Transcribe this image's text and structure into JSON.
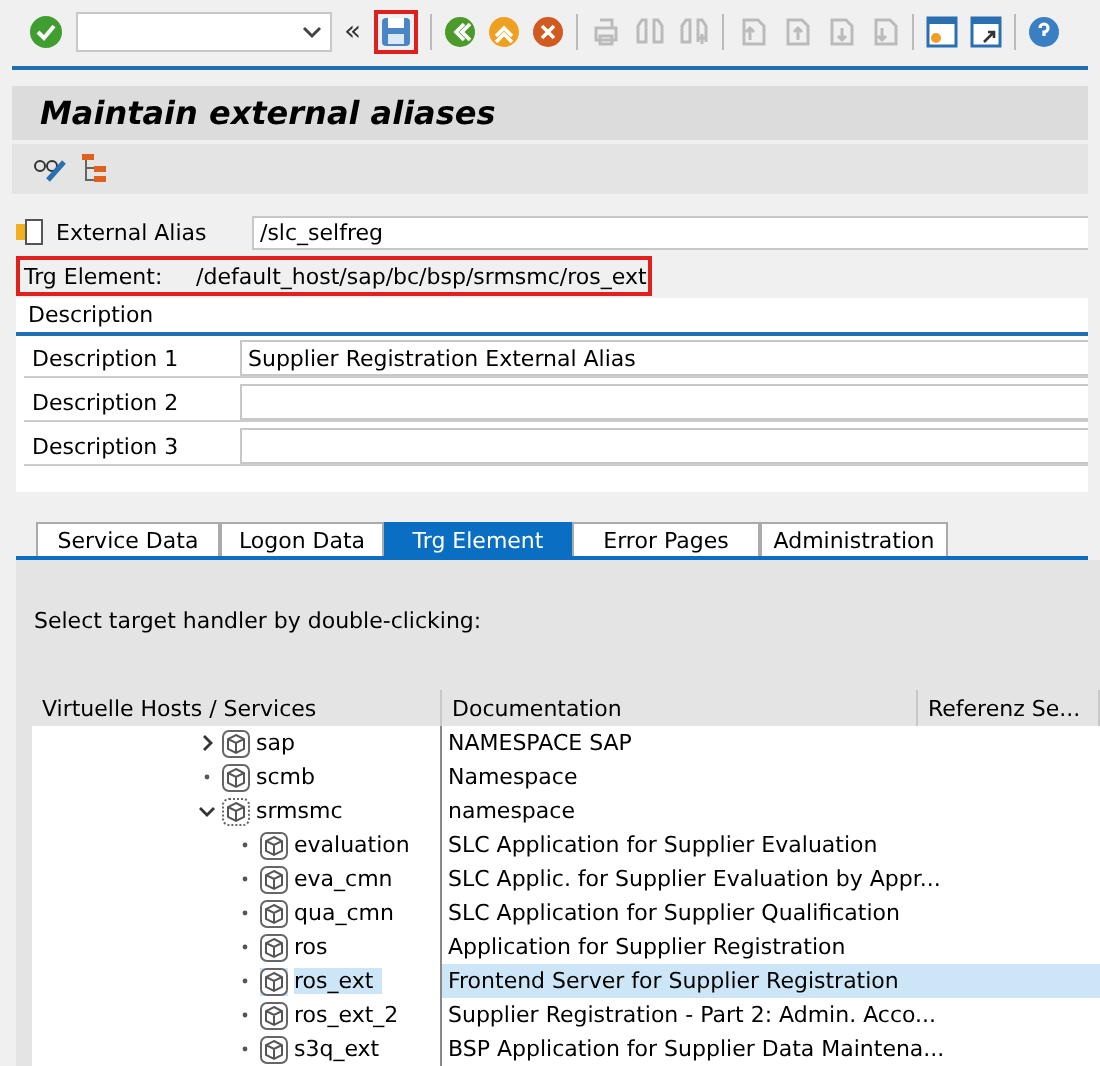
{
  "toolbar": {
    "nav_symbol": "«"
  },
  "title": "Maintain external aliases",
  "alias": {
    "label": "External Alias",
    "value": "/slc_selfreg"
  },
  "target": {
    "label": "Trg Element:",
    "value": "/default_host/sap/bc/bsp/srmsmc/ros_ext"
  },
  "description": {
    "heading": "Description",
    "rows": [
      {
        "label": "Description 1",
        "value": "Supplier Registration External Alias"
      },
      {
        "label": "Description 2",
        "value": ""
      },
      {
        "label": "Description 3",
        "value": ""
      }
    ]
  },
  "tabs": [
    {
      "label": "Service Data",
      "selected": false
    },
    {
      "label": "Logon Data",
      "selected": false
    },
    {
      "label": "Trg Element",
      "selected": true
    },
    {
      "label": "Error Pages",
      "selected": false
    },
    {
      "label": "Administration",
      "selected": false
    }
  ],
  "hint": "Select target handler by double-clicking:",
  "tree": {
    "columns": [
      "Virtuelle Hosts / Services",
      "Documentation",
      "Referenz Se..."
    ],
    "items": [
      {
        "name": "sap",
        "doc": "NAMESPACE SAP",
        "expanded": false,
        "has_children": true,
        "selected": false
      },
      {
        "name": "scmb",
        "doc": "Namespace",
        "has_children": false,
        "selected": false
      },
      {
        "name": "srmsmc",
        "doc": "namespace",
        "expanded": true,
        "has_children": true,
        "selected": false,
        "children": [
          {
            "name": "evaluation",
            "doc": "SLC Application for Supplier Evaluation",
            "selected": false
          },
          {
            "name": "eva_cmn",
            "doc": "SLC Applic. for Supplier Evaluation by Appr...",
            "selected": false
          },
          {
            "name": "qua_cmn",
            "doc": "SLC Application for Supplier Qualification",
            "selected": false
          },
          {
            "name": "ros",
            "doc": "Application for Supplier Registration",
            "selected": false
          },
          {
            "name": "ros_ext",
            "doc": "Frontend Server for Supplier Registration",
            "selected": true
          },
          {
            "name": "ros_ext_2",
            "doc": "Supplier Registration - Part 2: Admin. Acco...",
            "selected": false
          },
          {
            "name": "s3q_ext",
            "doc": "BSP Application for Supplier Data Maintena...",
            "selected": false
          }
        ]
      }
    ]
  }
}
